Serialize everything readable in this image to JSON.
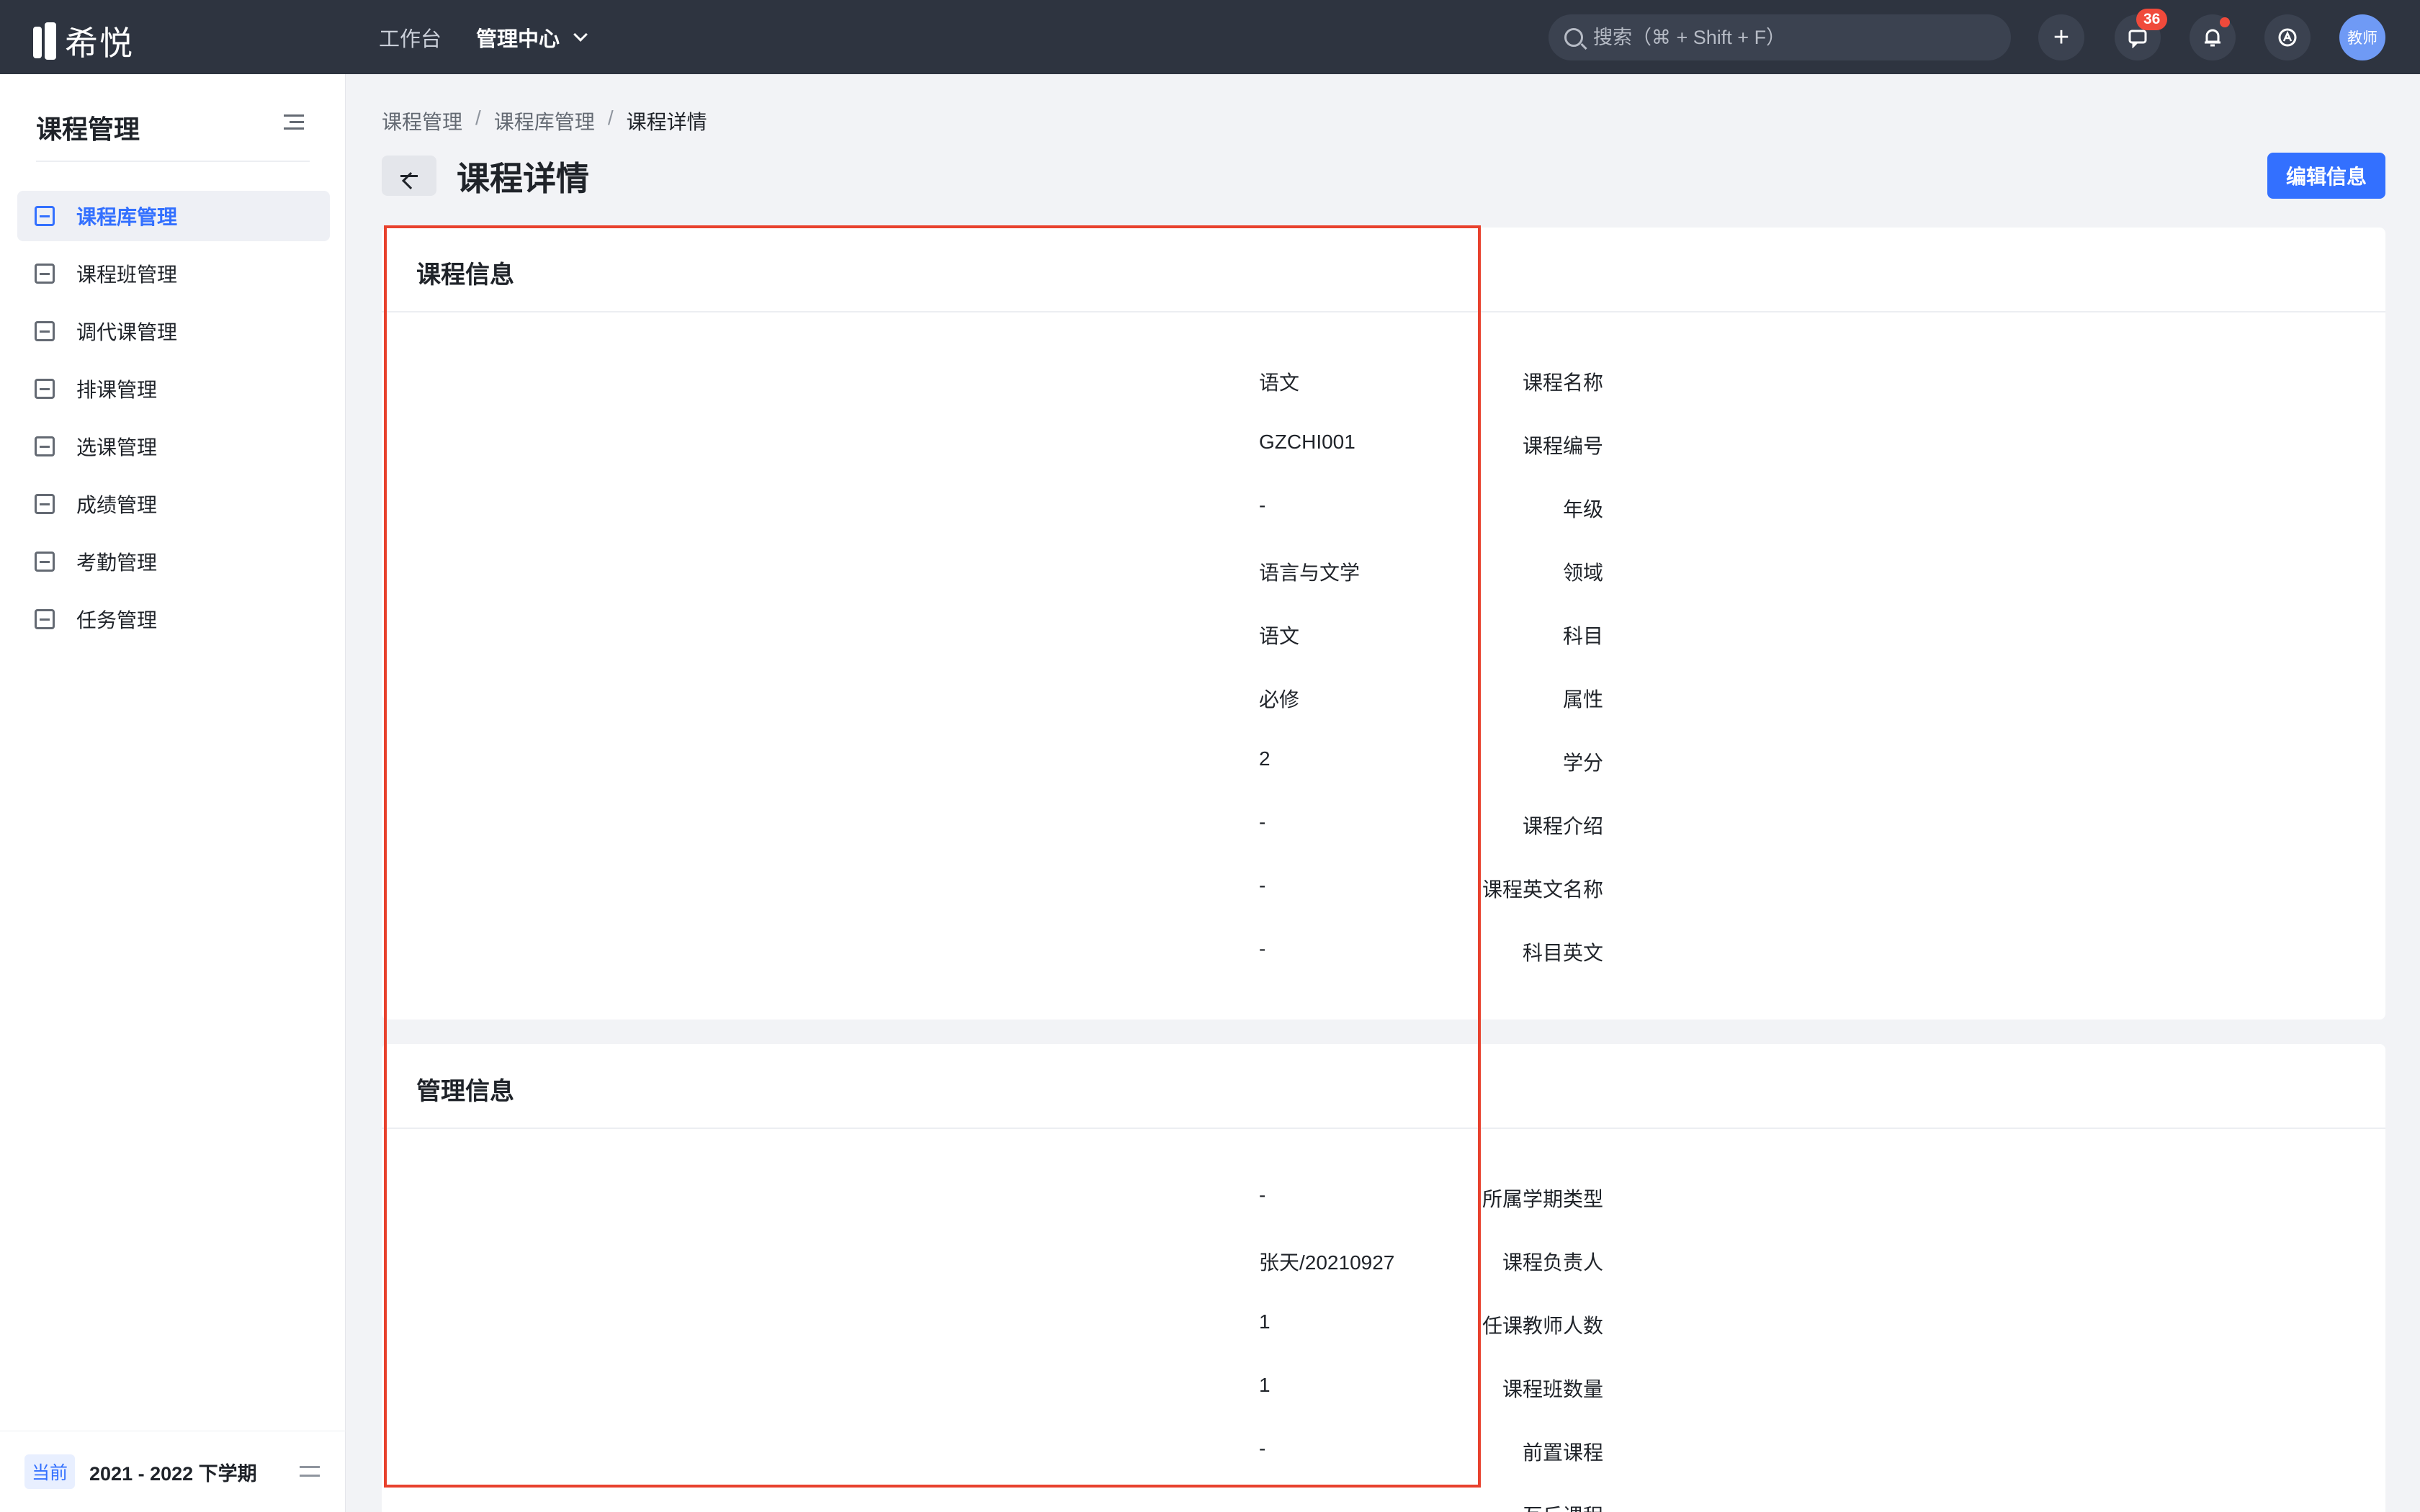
{
  "app": {
    "logo_text": "希悦"
  },
  "topnav": {
    "items": [
      {
        "label": "工作台"
      },
      {
        "label": "管理中心"
      }
    ]
  },
  "search": {
    "placeholder": "搜索（⌘ + Shift + F）"
  },
  "header": {
    "plus": "+",
    "messages_badge": "36",
    "avatar": "教师"
  },
  "sidebar": {
    "title": "课程管理",
    "items": [
      {
        "label": "课程库管理"
      },
      {
        "label": "课程班管理"
      },
      {
        "label": "调代课管理"
      },
      {
        "label": "排课管理"
      },
      {
        "label": "选课管理"
      },
      {
        "label": "成绩管理"
      },
      {
        "label": "考勤管理"
      },
      {
        "label": "任务管理"
      }
    ],
    "term_tag": "当前",
    "term": "2021 - 2022 下学期"
  },
  "breadcrumb": {
    "items": [
      "课程管理",
      "课程库管理",
      "课程详情"
    ],
    "separator": "/"
  },
  "page": {
    "title": "课程详情",
    "edit_label": "编辑信息"
  },
  "course_info": {
    "title": "课程信息",
    "fields": [
      {
        "label": "课程名称",
        "value": "语文"
      },
      {
        "label": "课程编号",
        "value": "GZCHI001"
      },
      {
        "label": "年级",
        "value": "-"
      },
      {
        "label": "领域",
        "value": "语言与文学"
      },
      {
        "label": "科目",
        "value": "语文"
      },
      {
        "label": "属性",
        "value": "必修"
      },
      {
        "label": "学分",
        "value": "2"
      },
      {
        "label": "课程介绍",
        "value": "-"
      },
      {
        "label": "课程英文名称",
        "value": "-"
      },
      {
        "label": "科目英文",
        "value": "-"
      }
    ]
  },
  "management_info": {
    "title": "管理信息",
    "fields": [
      {
        "label": "所属学期类型",
        "value": "-"
      },
      {
        "label": "课程负责人",
        "value": "张天/20210927"
      },
      {
        "label": "任课教师人数",
        "value": "1"
      },
      {
        "label": "课程班数量",
        "value": "1"
      },
      {
        "label": "前置课程",
        "value": "-"
      },
      {
        "label": "互斥课程",
        "value": "-"
      }
    ]
  },
  "colors": {
    "accent": "#3370ff",
    "topbar": "#2e3440",
    "highlight": "#e8412d",
    "badge": "#f04a3b"
  }
}
